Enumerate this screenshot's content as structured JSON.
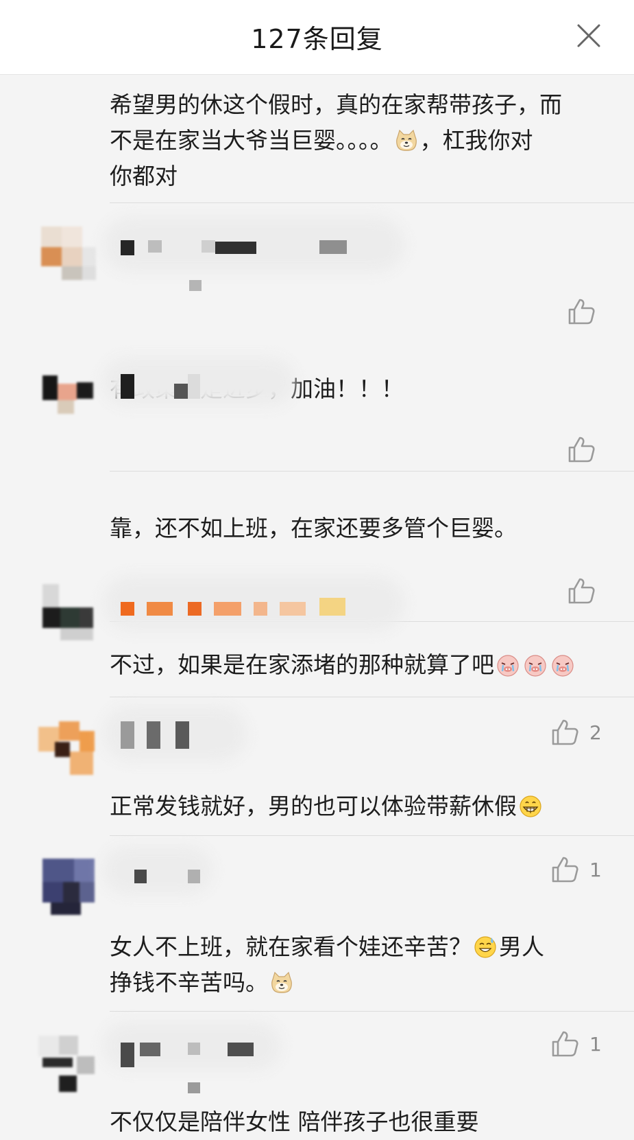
{
  "header": {
    "title": "127条回复"
  },
  "colors": {
    "like_icon": "#9a9a9a",
    "text": "#1d1d1d",
    "count": "#8a8a8a"
  },
  "comments": [
    {
      "text_lines": [
        "希望男的休这个假时，真的在家帮带孩子，而",
        "不是在家当大爷当巨婴。。。。",
        "，杠我你对",
        "你都对"
      ],
      "emoji": "doge-emoji"
    },
    {
      "text": "有政策就是进步，加油！！！"
    },
    {
      "text": "靠，还不如上班，在家还要多管个巨婴。"
    },
    {
      "text": "不过，如果是在家添堵的那种就算了吧",
      "emoji": "crying-pig-emoji"
    },
    {
      "text": "正常发钱就好，男的也可以体验带薪休假",
      "emoji": "grin-emoji",
      "likes": "2"
    },
    {
      "text_lines": [
        "女人不上班，就在家看个娃还辛苦？",
        "男人",
        "挣钱不辛苦吗。"
      ],
      "emoji": [
        "sweat-smile-emoji",
        "doge-emoji"
      ],
      "likes": "1"
    },
    {
      "text": "不仅仅是陪伴女性 陪伴孩子也很重要",
      "likes": "1"
    }
  ]
}
